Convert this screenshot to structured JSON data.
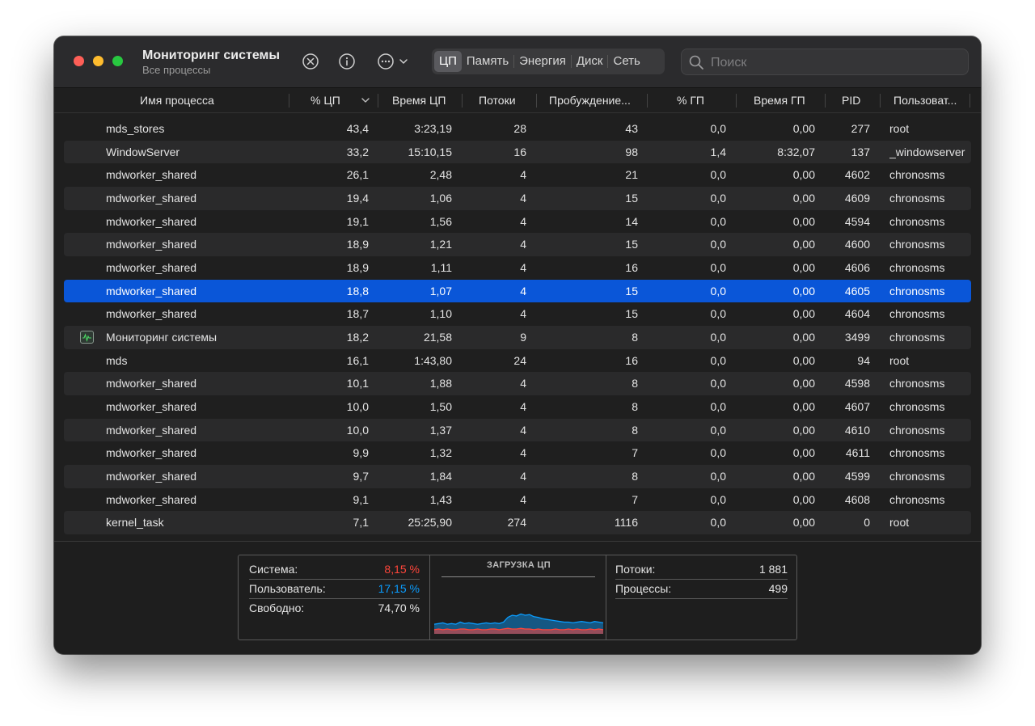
{
  "window": {
    "title": "Мониторинг системы",
    "subtitle": "Все процессы"
  },
  "toolbar": {
    "icons": [
      "close-circle-icon",
      "info-icon",
      "more-icon",
      "chevron-down-icon"
    ],
    "tabs": [
      {
        "label": "ЦП",
        "active": true
      },
      {
        "label": "Память",
        "active": false
      },
      {
        "label": "Энергия",
        "active": false
      },
      {
        "label": "Диск",
        "active": false
      },
      {
        "label": "Сеть",
        "active": false
      }
    ],
    "search_placeholder": "Поиск"
  },
  "table": {
    "columns": [
      "Имя процесса",
      "% ЦП",
      "Время ЦП",
      "Потоки",
      "Пробуждение...",
      "% ГП",
      "Время ГП",
      "PID",
      "Пользоват..."
    ],
    "sorted_column": "% ЦП",
    "rows": [
      {
        "name": "mds_stores",
        "cpu": "43,4",
        "cpu_time": "3:23,19",
        "threads": "28",
        "wakeups": "43",
        "gpu": "0,0",
        "gpu_time": "0,00",
        "pid": "277",
        "user": "root"
      },
      {
        "name": "WindowServer",
        "cpu": "33,2",
        "cpu_time": "15:10,15",
        "threads": "16",
        "wakeups": "98",
        "gpu": "1,4",
        "gpu_time": "8:32,07",
        "pid": "137",
        "user": "_windowserver"
      },
      {
        "name": "mdworker_shared",
        "cpu": "26,1",
        "cpu_time": "2,48",
        "threads": "4",
        "wakeups": "21",
        "gpu": "0,0",
        "gpu_time": "0,00",
        "pid": "4602",
        "user": "chronosms"
      },
      {
        "name": "mdworker_shared",
        "cpu": "19,4",
        "cpu_time": "1,06",
        "threads": "4",
        "wakeups": "15",
        "gpu": "0,0",
        "gpu_time": "0,00",
        "pid": "4609",
        "user": "chronosms"
      },
      {
        "name": "mdworker_shared",
        "cpu": "19,1",
        "cpu_time": "1,56",
        "threads": "4",
        "wakeups": "14",
        "gpu": "0,0",
        "gpu_time": "0,00",
        "pid": "4594",
        "user": "chronosms"
      },
      {
        "name": "mdworker_shared",
        "cpu": "18,9",
        "cpu_time": "1,21",
        "threads": "4",
        "wakeups": "15",
        "gpu": "0,0",
        "gpu_time": "0,00",
        "pid": "4600",
        "user": "chronosms"
      },
      {
        "name": "mdworker_shared",
        "cpu": "18,9",
        "cpu_time": "1,11",
        "threads": "4",
        "wakeups": "16",
        "gpu": "0,0",
        "gpu_time": "0,00",
        "pid": "4606",
        "user": "chronosms"
      },
      {
        "name": "mdworker_shared",
        "cpu": "18,8",
        "cpu_time": "1,07",
        "threads": "4",
        "wakeups": "15",
        "gpu": "0,0",
        "gpu_time": "0,00",
        "pid": "4605",
        "user": "chronosms",
        "selected": true
      },
      {
        "name": "mdworker_shared",
        "cpu": "18,7",
        "cpu_time": "1,10",
        "threads": "4",
        "wakeups": "15",
        "gpu": "0,0",
        "gpu_time": "0,00",
        "pid": "4604",
        "user": "chronosms"
      },
      {
        "name": "Мониторинг системы",
        "cpu": "18,2",
        "cpu_time": "21,58",
        "threads": "9",
        "wakeups": "8",
        "gpu": "0,0",
        "gpu_time": "0,00",
        "pid": "3499",
        "user": "chronosms",
        "icon": "activity-monitor-icon"
      },
      {
        "name": "mds",
        "cpu": "16,1",
        "cpu_time": "1:43,80",
        "threads": "24",
        "wakeups": "16",
        "gpu": "0,0",
        "gpu_time": "0,00",
        "pid": "94",
        "user": "root"
      },
      {
        "name": "mdworker_shared",
        "cpu": "10,1",
        "cpu_time": "1,88",
        "threads": "4",
        "wakeups": "8",
        "gpu": "0,0",
        "gpu_time": "0,00",
        "pid": "4598",
        "user": "chronosms"
      },
      {
        "name": "mdworker_shared",
        "cpu": "10,0",
        "cpu_time": "1,50",
        "threads": "4",
        "wakeups": "8",
        "gpu": "0,0",
        "gpu_time": "0,00",
        "pid": "4607",
        "user": "chronosms"
      },
      {
        "name": "mdworker_shared",
        "cpu": "10,0",
        "cpu_time": "1,37",
        "threads": "4",
        "wakeups": "8",
        "gpu": "0,0",
        "gpu_time": "0,00",
        "pid": "4610",
        "user": "chronosms"
      },
      {
        "name": "mdworker_shared",
        "cpu": "9,9",
        "cpu_time": "1,32",
        "threads": "4",
        "wakeups": "7",
        "gpu": "0,0",
        "gpu_time": "0,00",
        "pid": "4611",
        "user": "chronosms"
      },
      {
        "name": "mdworker_shared",
        "cpu": "9,7",
        "cpu_time": "1,84",
        "threads": "4",
        "wakeups": "8",
        "gpu": "0,0",
        "gpu_time": "0,00",
        "pid": "4599",
        "user": "chronosms"
      },
      {
        "name": "mdworker_shared",
        "cpu": "9,1",
        "cpu_time": "1,43",
        "threads": "4",
        "wakeups": "7",
        "gpu": "0,0",
        "gpu_time": "0,00",
        "pid": "4608",
        "user": "chronosms"
      },
      {
        "name": "kernel_task",
        "cpu": "7,1",
        "cpu_time": "25:25,90",
        "threads": "274",
        "wakeups": "1116",
        "gpu": "0,0",
        "gpu_time": "0,00",
        "pid": "0",
        "user": "root"
      }
    ]
  },
  "summary": {
    "system_label": "Система:",
    "system_value": "8,15 %",
    "user_label": "Пользователь:",
    "user_value": "17,15 %",
    "idle_label": "Свободно:",
    "idle_value": "74,70 %",
    "graph_title": "ЗАГРУЗКА ЦП",
    "threads_label": "Потоки:",
    "threads_value": "1 881",
    "processes_label": "Процессы:",
    "processes_value": "499"
  },
  "colors": {
    "system": "#ff453a",
    "user": "#0a9dff",
    "selection": "#0a56d8"
  },
  "chart_data": {
    "type": "area",
    "title": "ЗАГРУЗКА ЦП",
    "series": [
      {
        "name": "Система",
        "values": [
          6,
          7,
          6,
          7,
          6,
          6,
          7,
          7,
          6,
          6,
          7,
          6,
          6,
          7,
          7,
          6,
          7,
          8,
          7,
          7,
          8,
          7,
          7,
          6,
          7,
          6,
          6,
          6,
          7,
          6,
          6,
          7,
          6,
          7,
          6,
          6,
          7,
          6,
          7,
          6
        ]
      },
      {
        "name": "Пользователь",
        "values": [
          14,
          15,
          16,
          14,
          15,
          14,
          17,
          15,
          16,
          15,
          14,
          15,
          16,
          15,
          16,
          15,
          17,
          24,
          27,
          26,
          29,
          27,
          28,
          25,
          24,
          22,
          21,
          20,
          19,
          18,
          17,
          17,
          16,
          17,
          18,
          17,
          16,
          18,
          17,
          16
        ]
      }
    ],
    "ylim": [
      0,
      100
    ]
  }
}
